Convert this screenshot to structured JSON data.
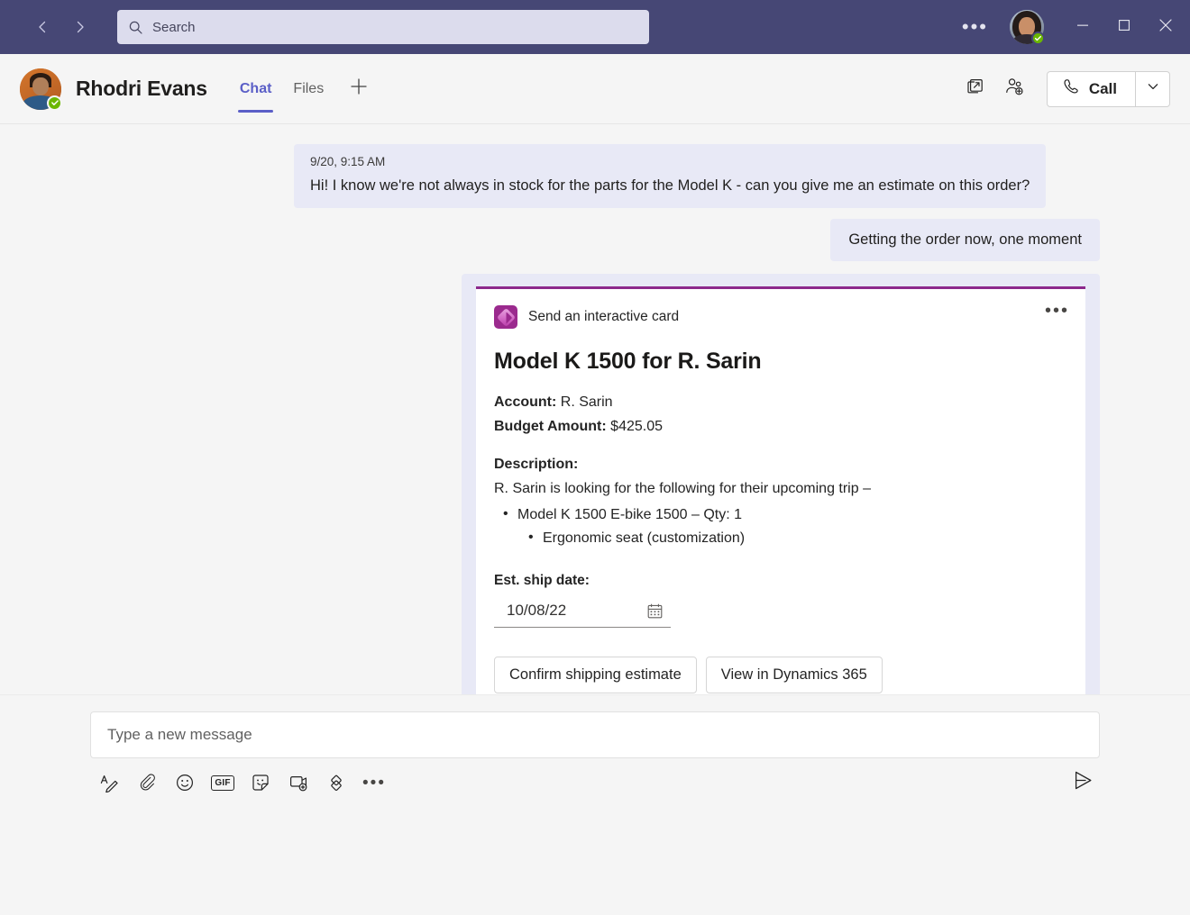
{
  "titlebar": {
    "back_icon": "chevron-left-icon",
    "forward_icon": "chevron-right-icon",
    "search": {
      "placeholder": "Search",
      "value": "",
      "icon": "search-icon"
    },
    "more_label": "•••",
    "avatar_status": "available",
    "minimize_label": "Minimize",
    "maximize_label": "Maximize",
    "close_label": "Close",
    "background_color": "#464775"
  },
  "chat_header": {
    "contact_name": "Rhodri Evans",
    "contact_status": "available",
    "tabs": [
      {
        "label": "Chat",
        "active": true
      },
      {
        "label": "Files",
        "active": false
      }
    ],
    "add_tab_icon": "plus-icon",
    "popout_icon": "pop-out-icon",
    "add_people_icon": "add-person-icon",
    "call_label": "Call",
    "call_icon": "phone-icon",
    "call_dropdown_icon": "chevron-down-icon",
    "accent_color": "#5b5fc7"
  },
  "messages": [
    {
      "direction": "incoming",
      "time": "9/20, 9:15 AM",
      "text": "Hi! I know we're not always in stock for the parts for the Model K - can you give me an estimate on this order?"
    },
    {
      "direction": "outgoing",
      "text": "Getting the order now, one moment"
    }
  ],
  "card": {
    "app_name": "Send an interactive card",
    "app_icon": "power-automate-icon",
    "more_label": "•••",
    "accent_color": "#8c288c",
    "title": "Model K 1500 for R. Sarin",
    "fields": [
      {
        "label": "Account:",
        "value": "R. Sarin"
      },
      {
        "label": "Budget Amount:",
        "value": "$425.05"
      }
    ],
    "description_label": "Description:",
    "description_text": "R. Sarin is looking for the following for their upcoming trip –",
    "bullets": [
      {
        "text": "Model K 1500 E-bike 1500 – Qty: 1",
        "level": 1
      },
      {
        "text": "Ergonomic seat (customization)",
        "level": 2
      }
    ],
    "date_field": {
      "label": "Est. ship date:",
      "value": "10/08/22",
      "icon": "calendar-icon"
    },
    "actions": [
      {
        "label": "Confirm shipping estimate"
      },
      {
        "label": "View in Dynamics 365"
      }
    ]
  },
  "compose": {
    "placeholder": "Type a new message",
    "value": "",
    "tools": [
      {
        "name": "format-icon",
        "label": "Format"
      },
      {
        "name": "attach-icon",
        "label": "Attach"
      },
      {
        "name": "emoji-icon",
        "label": "Emoji"
      },
      {
        "name": "gif-icon",
        "label": "GIF"
      },
      {
        "name": "sticker-icon",
        "label": "Sticker"
      },
      {
        "name": "meet-now-icon",
        "label": "Meet now"
      },
      {
        "name": "loop-components-icon",
        "label": "Loop components"
      },
      {
        "name": "more-options-icon",
        "label": "•••"
      }
    ],
    "send_icon": "send-icon",
    "send_label": "Send"
  }
}
